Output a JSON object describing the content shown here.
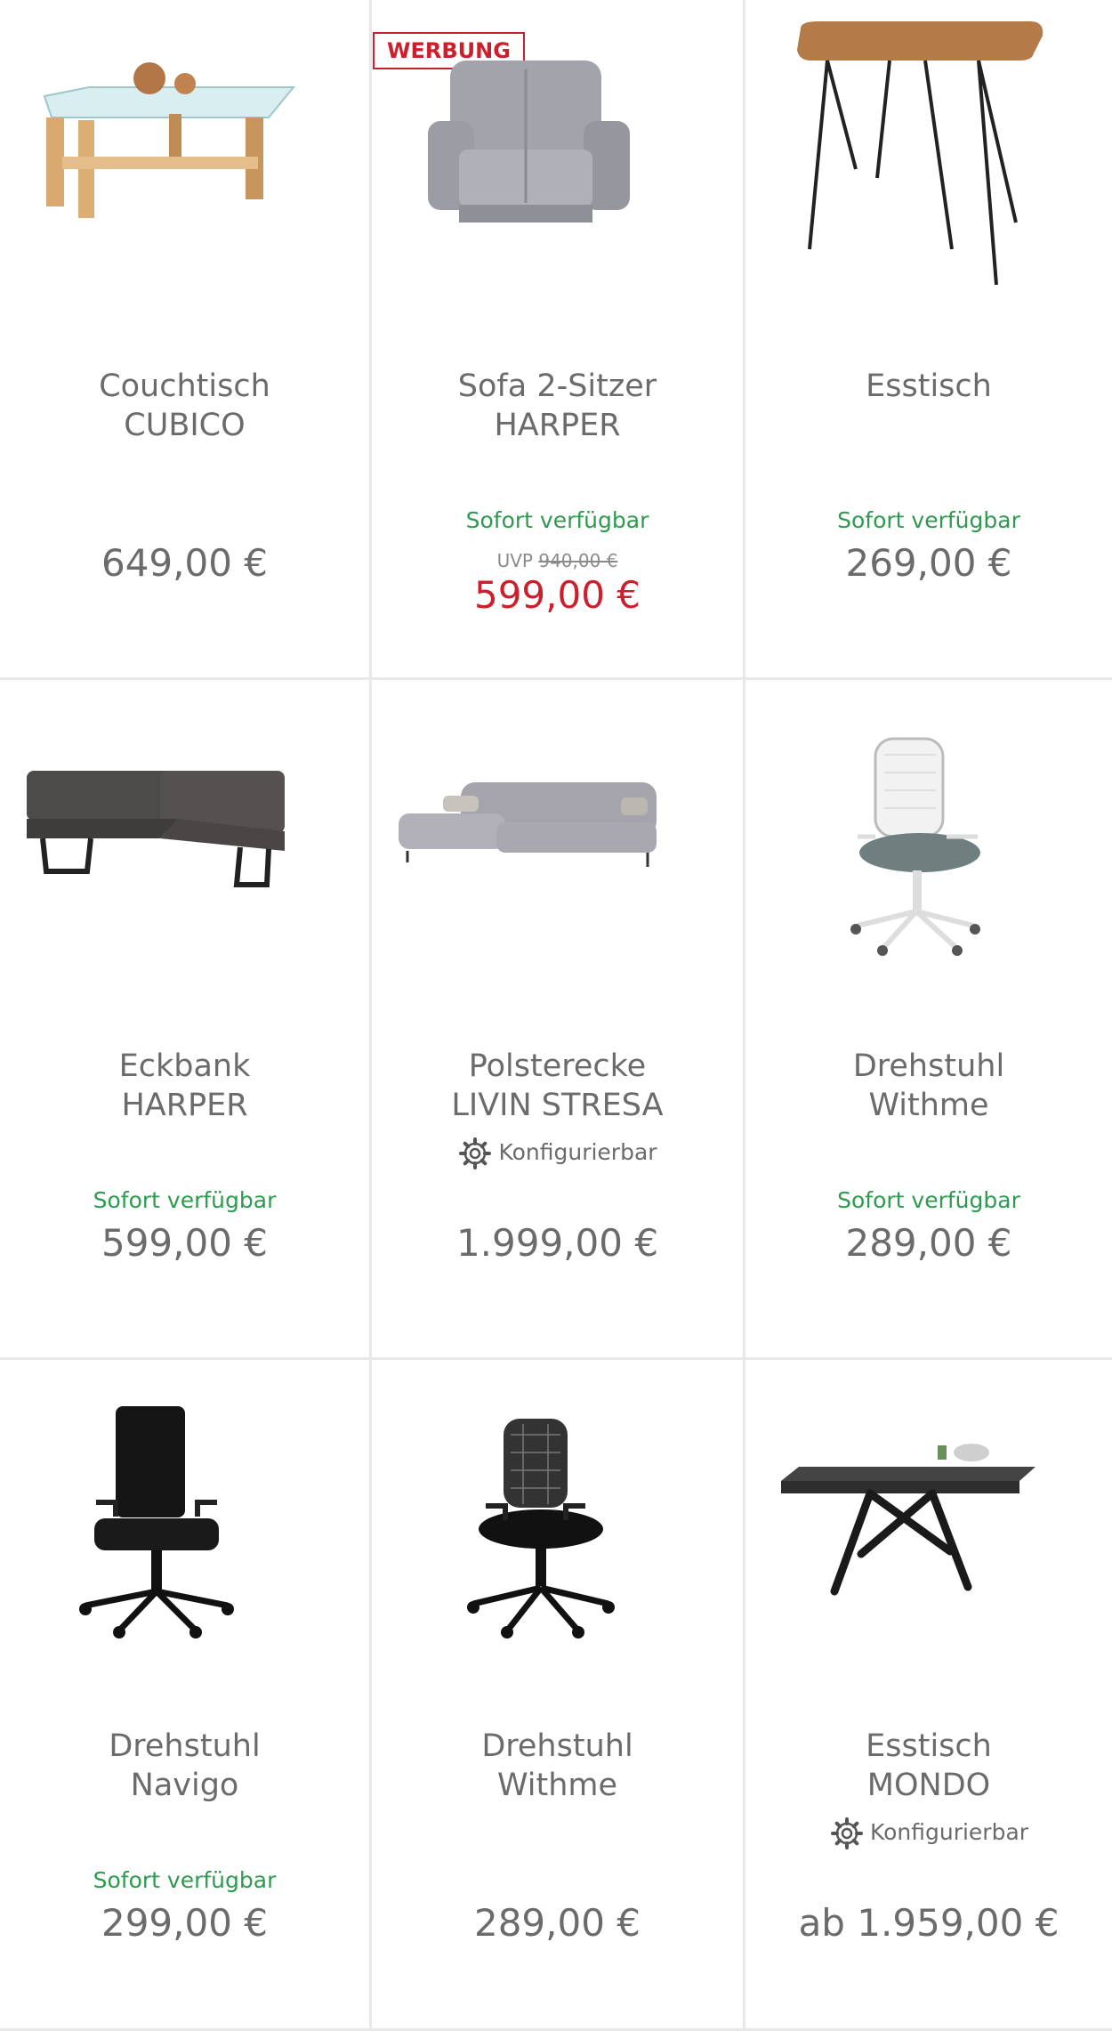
{
  "ad_badge": "WERBUNG",
  "colors": {
    "available": "#2e9a50",
    "sale": "#cc1f2d",
    "text": "#6b6b6b",
    "divider": "#e8e8e8"
  },
  "products": [
    {
      "name1": "Couchtisch",
      "name2": "CUBICO",
      "availability": "",
      "price": "649,00 €",
      "icon": "coffee-table-image"
    },
    {
      "name1": "Sofa 2-Sitzer",
      "name2": "HARPER",
      "availability": "Sofort verfügbar",
      "uvp_label": "UVP",
      "uvp_price": "940,00 €",
      "price": "599,00 €",
      "icon": "sofa-image"
    },
    {
      "name1": "Esstisch",
      "name2": "",
      "availability": "Sofort verfügbar",
      "price": "269,00 €",
      "icon": "dining-table-image"
    },
    {
      "name1": "Eckbank",
      "name2": "HARPER",
      "availability": "Sofort verfügbar",
      "price": "599,00 €",
      "icon": "corner-bench-image"
    },
    {
      "name1": "Polsterecke",
      "name2": "LIVIN STRESA",
      "config": "Konfigurierbar",
      "availability": "",
      "price": "1.999,00 €",
      "icon": "corner-sofa-image"
    },
    {
      "name1": "Drehstuhl",
      "name2": "Withme",
      "availability": "Sofort verfügbar",
      "price": "289,00 €",
      "icon": "office-chair-white-image"
    },
    {
      "name1": "Drehstuhl",
      "name2": "Navigo",
      "availability": "Sofort verfügbar",
      "price": "299,00 €",
      "icon": "office-chair-black-image"
    },
    {
      "name1": "Drehstuhl",
      "name2": "Withme",
      "availability": "",
      "price": "289,00 €",
      "icon": "office-chair-mesh-image"
    },
    {
      "name1": "Esstisch",
      "name2": "MONDO",
      "config": "Konfigurierbar",
      "availability": "",
      "price": "ab 1.959,00 €",
      "icon": "extendable-table-image"
    }
  ]
}
